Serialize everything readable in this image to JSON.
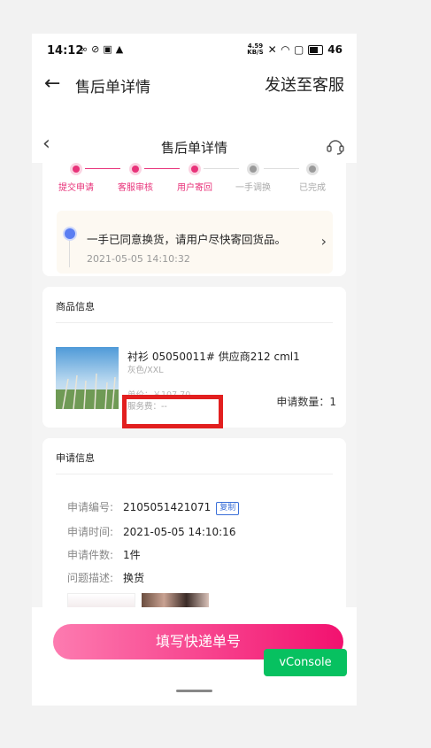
{
  "status_bar": {
    "time": "14:12",
    "left_icons": [
      "infinity-icon",
      "check-circle-icon",
      "upload-box-icon",
      "warning-icon"
    ],
    "speed_value": "4.59",
    "speed_unit": "KB/S",
    "battery": "46"
  },
  "app_bar": {
    "title": "售后单详情",
    "action": "发送至客服"
  },
  "page_header": {
    "title": "售后单详情"
  },
  "steps": [
    {
      "label": "提交申请",
      "state": "active"
    },
    {
      "label": "客服审核",
      "state": "active"
    },
    {
      "label": "用户寄回",
      "state": "active"
    },
    {
      "label": "一手调换",
      "state": "inactive"
    },
    {
      "label": "已完成",
      "state": "inactive"
    }
  ],
  "notice": {
    "text": "一手已同意换货，请用户尽快寄回货品。",
    "time": "2021-05-05 14:10:32"
  },
  "product": {
    "section_title": "商品信息",
    "name": "衬衫 05050011# 供应商212 cml1",
    "spec": "灰色/XXL",
    "price": "单价：￥107.70",
    "service_fee": "服务费：--",
    "quantity": "申请数量：1"
  },
  "apply": {
    "section_title": "申请信息",
    "rows": [
      {
        "key": "申请编号:",
        "value": "2105051421071",
        "badge": "复制"
      },
      {
        "key": "申请时间:",
        "value": "2021-05-05 14:10:16"
      },
      {
        "key": "申请件数:",
        "value": "1件"
      },
      {
        "key": "问题描述:",
        "value": "换货"
      }
    ]
  },
  "bottom": {
    "primary_button": "填写快递单号",
    "vconsole": "vConsole"
  },
  "colors": {
    "accent": "#e8337a",
    "button_start": "#fd7bb0",
    "button_end": "#f2116f",
    "vconsole": "#07c160",
    "highlight_box": "#e21f1f"
  }
}
